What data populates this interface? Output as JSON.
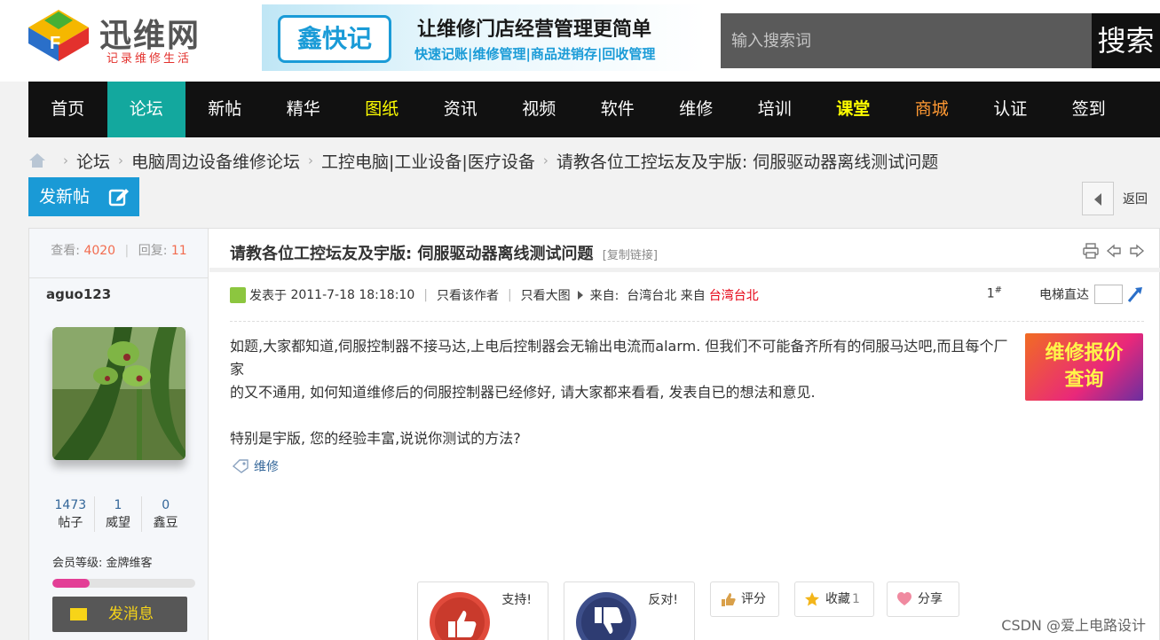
{
  "header": {
    "logo_name": "迅维网",
    "logo_slogan": "记录维修生活",
    "banner": {
      "badge": "鑫快记",
      "title": "让维修门店经营管理更简单",
      "subtitle": "快速记账|维修管理|商品进销存|回收管理"
    },
    "search_placeholder": "输入搜索词",
    "search_button": "搜索"
  },
  "nav": [
    {
      "label": "首页",
      "color": "#ffffff"
    },
    {
      "label": "论坛",
      "color": "#ffffff",
      "active": true
    },
    {
      "label": "新帖",
      "color": "#ffffff"
    },
    {
      "label": "精华",
      "color": "#ffffff"
    },
    {
      "label": "图纸",
      "color": "#ffff00"
    },
    {
      "label": "资讯",
      "color": "#ffffff"
    },
    {
      "label": "视频",
      "color": "#ffffff"
    },
    {
      "label": "软件",
      "color": "#ffffff"
    },
    {
      "label": "维修",
      "color": "#ffffff"
    },
    {
      "label": "培训",
      "color": "#ffffff"
    },
    {
      "label": "课堂",
      "color": "#ffff00",
      "bold": true
    },
    {
      "label": "商城",
      "color": "#ff9933"
    },
    {
      "label": "认证",
      "color": "#ffffff"
    },
    {
      "label": "签到",
      "color": "#ffffff"
    }
  ],
  "breadcrumb": [
    "论坛",
    "电脑周边设备维修论坛",
    "工控电脑|工业设备|医疗设备",
    "请教各位工控坛友及宇版: 伺服驱动器离线测试问题"
  ],
  "new_post_label": "发新帖",
  "back_label": "返回",
  "sidebar": {
    "views_label": "查看:",
    "views": "4020",
    "replies_label": "回复:",
    "replies": "11",
    "username": "aguo123",
    "stats": [
      {
        "num": "1473",
        "label": "帖子"
      },
      {
        "num": "1",
        "label": "威望"
      },
      {
        "num": "0",
        "label": "鑫豆"
      }
    ],
    "level_label": "会员等级:",
    "level_value": "金牌维客",
    "level_progress": 0.26,
    "message_button": "发消息"
  },
  "post": {
    "title": "请教各位工控坛友及宇版: 伺服驱动器离线测试问题",
    "copy_link": "[复制链接]",
    "posted_prefix": "发表于",
    "posted_time": "2011-7-18 18:18:10",
    "only_author": "只看该作者",
    "only_images": "只看大图",
    "from_label": "来自:",
    "from_value": "台湾台北 来自",
    "from_red": "台湾台北",
    "floor": "1",
    "floor_sup": "#",
    "elevator_label": "电梯直达",
    "paragraphs": [
      "如题,大家都知道,伺服控制器不接马达,上电后控制器会无输出电流而alarm.  但我们不可能备齐所有的伺服马达吧,而且每个厂家",
      "的又不通用, 如何知道维修后的伺服控制器已经修好,  请大家都来看看, 发表自已的想法和意见.",
      "",
      "特别是宇版, 您的经验丰富,说说你测试的方法?"
    ],
    "ad_line1": "维修报价",
    "ad_line2": "查询",
    "tag": "维修",
    "support_label": "支持!",
    "oppose_label": "反对!",
    "rate_label": "评分",
    "fav_label": "收藏",
    "fav_count": "1",
    "share_label": "分享"
  },
  "watermark": "CSDN @爱上电路设计"
}
